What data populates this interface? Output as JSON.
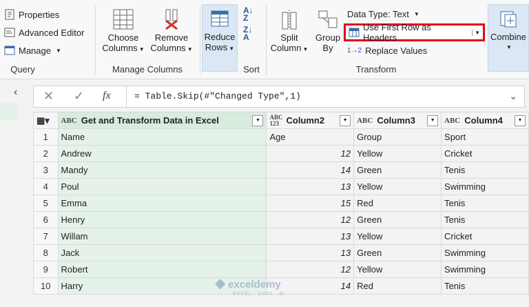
{
  "ribbon": {
    "query": {
      "properties": "Properties",
      "advanced_editor": "Advanced Editor",
      "manage": "Manage",
      "label": "Query"
    },
    "manage_columns": {
      "choose_line1": "Choose",
      "choose_line2": "Columns",
      "remove_line1": "Remove",
      "remove_line2": "Columns",
      "label": "Manage Columns"
    },
    "reduce": {
      "line1": "Reduce",
      "line2": "Rows"
    },
    "sort": {
      "label": "Sort"
    },
    "transform": {
      "split_line1": "Split",
      "split_line2": "Column",
      "group_line1": "Group",
      "group_line2": "By",
      "data_type": "Data Type: Text",
      "use_first_row": "Use First Row as Headers",
      "replace_values": "Replace Values",
      "label": "Transform"
    },
    "combine": {
      "label": "Combine"
    },
    "highlight_color": "#e0001b"
  },
  "formula": {
    "text": "= Table.Skip(#\"Changed Type\",1)",
    "fx": "fx"
  },
  "table": {
    "headers": [
      {
        "type": "ABC",
        "name": "Get and Transform Data in Excel"
      },
      {
        "type": "ABC 123",
        "name": "Column2"
      },
      {
        "type": "ABC",
        "name": "Column3"
      },
      {
        "type": "ABC",
        "name": "Column4"
      }
    ],
    "rows": [
      {
        "n": "1",
        "c1": "Name",
        "c2": "Age",
        "c3": "Group",
        "c4": "Sport"
      },
      {
        "n": "2",
        "c1": "Andrew",
        "c2": "12",
        "c3": "Yellow",
        "c4": "Cricket"
      },
      {
        "n": "3",
        "c1": "Mandy",
        "c2": "14",
        "c3": "Green",
        "c4": "Tenis"
      },
      {
        "n": "4",
        "c1": "Poul",
        "c2": "13",
        "c3": "Yellow",
        "c4": "Swimming"
      },
      {
        "n": "5",
        "c1": "Emma",
        "c2": "15",
        "c3": "Red",
        "c4": "Tenis"
      },
      {
        "n": "6",
        "c1": "Henry",
        "c2": "12",
        "c3": "Green",
        "c4": "Tenis"
      },
      {
        "n": "7",
        "c1": "Willam",
        "c2": "13",
        "c3": "Yellow",
        "c4": "Cricket"
      },
      {
        "n": "8",
        "c1": "Jack",
        "c2": "13",
        "c3": "Green",
        "c4": "Swimming"
      },
      {
        "n": "9",
        "c1": "Robert",
        "c2": "12",
        "c3": "Yellow",
        "c4": "Swimming"
      },
      {
        "n": "10",
        "c1": "Harry",
        "c2": "14",
        "c3": "Red",
        "c4": "Tenis"
      }
    ]
  },
  "watermark": {
    "brand": "exceldemy",
    "tagline": "EXCEL · DATA · BI"
  }
}
